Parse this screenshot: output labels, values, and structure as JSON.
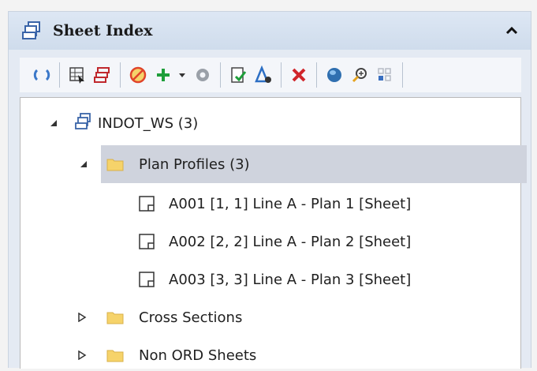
{
  "panel": {
    "title": "Sheet Index"
  },
  "toolbar": {
    "buttons": [
      "refresh-icon",
      "sheet-grid-icon",
      "multi-sheet-icon",
      "delete-circle-icon",
      "add-icon",
      "settings-icon",
      "document-check-icon",
      "triangle-tool-icon",
      "close-icon",
      "globe-icon",
      "zoom-icon",
      "grid-icon"
    ]
  },
  "tree": {
    "root": {
      "label": "INDOT_WS (3)"
    },
    "folders": [
      {
        "label": "Plan Profiles (3)"
      },
      {
        "label": "Cross Sections"
      },
      {
        "label": "Non ORD Sheets"
      }
    ],
    "sheets": [
      {
        "label": "A001 [1, 1] Line A - Plan 1 [Sheet]"
      },
      {
        "label": "A002 [2, 2] Line A - Plan 2 [Sheet]"
      },
      {
        "label": "A003 [3, 3] Line A - Plan 3 [Sheet]"
      }
    ]
  },
  "colors": {
    "folder": "#f6d36a",
    "selection": "#cfd3dd",
    "header": "#dde7f4"
  }
}
